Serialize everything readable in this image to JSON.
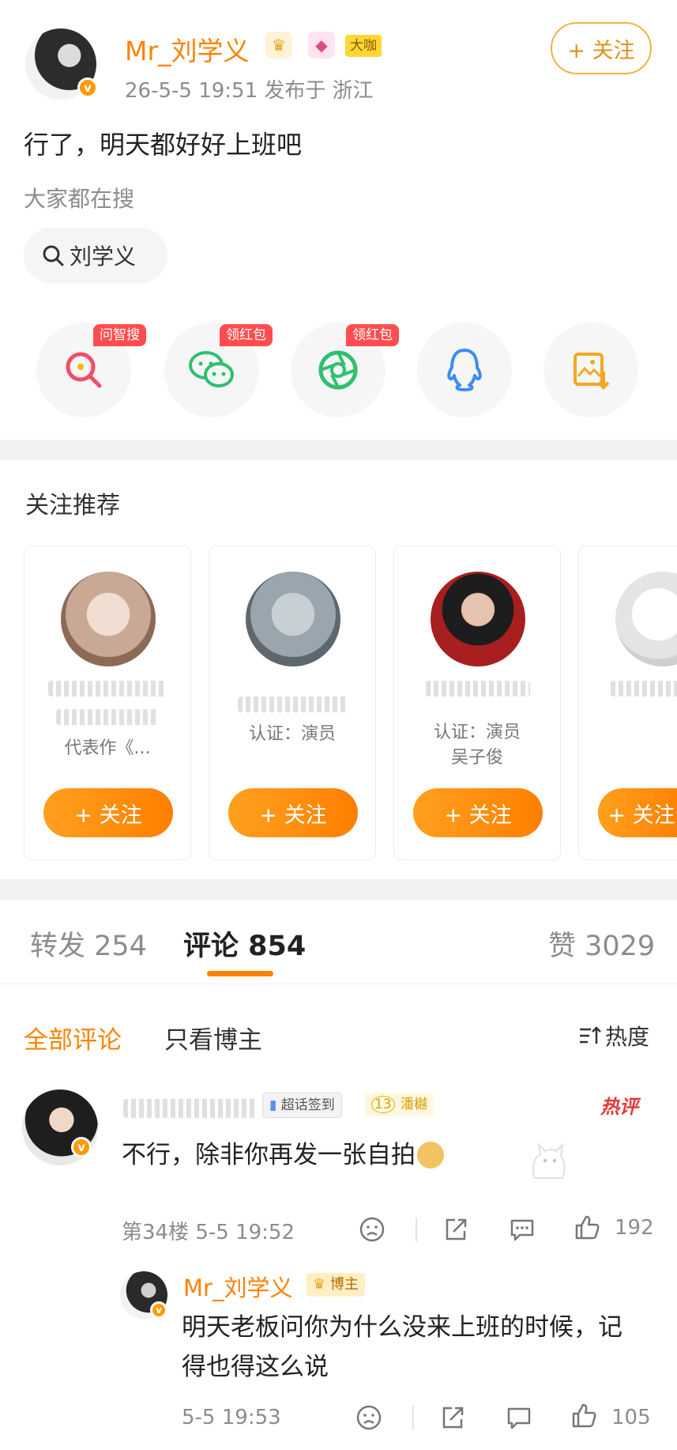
{
  "post": {
    "username": "Mr_刘学义",
    "badge_tag": "大咖",
    "verify_mark": "v",
    "meta": "26-5-5 19:51  发布于 浙江",
    "follow_label": "+ 关注",
    "text": "行了，明天都好好上班吧",
    "search_hint": "大家都在搜",
    "search_chip": "刘学义"
  },
  "share": {
    "items": [
      {
        "icon": "ai-search-icon",
        "tag": "问智搜",
        "color": "#ff4d4f"
      },
      {
        "icon": "wechat-icon",
        "tag": "领红包",
        "color": "#2fbf71"
      },
      {
        "icon": "moments-icon",
        "tag": "领红包",
        "color": "#2fbf71"
      },
      {
        "icon": "qq-icon",
        "tag": "",
        "color": "#3b8ef0"
      },
      {
        "icon": "save-image-icon",
        "tag": "",
        "color": "#f5a623"
      }
    ]
  },
  "recommend": {
    "title": "关注推荐",
    "follow_label": "+ 关注",
    "cards": [
      {
        "desc": "代表作《...",
        "avatar_color": "#c9a995"
      },
      {
        "desc": "认证：演员",
        "avatar_color": "#9aa6ad"
      },
      {
        "desc": "认证：演员吴子俊",
        "avatar_color": "#7a1f1f"
      },
      {
        "desc": "",
        "avatar_color": "#eeeeee"
      }
    ]
  },
  "tabs": {
    "repost": "转发 254",
    "comment": "评论 854",
    "like": "赞 3029"
  },
  "filters": {
    "all": "全部评论",
    "author_only": "只看博主",
    "sort": "热度"
  },
  "comment1": {
    "chip_checkin": "超话签到",
    "chip_level": "13",
    "chip_level_name": "潘樾",
    "hot": "热评",
    "text": "不行，除非你再发一张自拍",
    "meta": "第34楼  5-5 19:52",
    "likes": "192"
  },
  "reply1": {
    "username": "Mr_刘学义",
    "author_tag": "博主",
    "text": "明天老板问你为什么没来上班的时候，记得也得这么说",
    "meta": "5-5 19:53",
    "likes": "105"
  },
  "colors": {
    "accent": "#ff8200",
    "divider": "#f2f2f2"
  }
}
